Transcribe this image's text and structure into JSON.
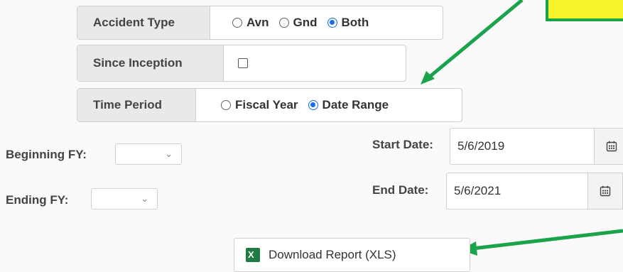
{
  "accident_type": {
    "label": "Accident Type",
    "options": [
      {
        "label": "Avn",
        "checked": false
      },
      {
        "label": "Gnd",
        "checked": false
      },
      {
        "label": "Both",
        "checked": true
      }
    ]
  },
  "since_inception": {
    "label": "Since Inception",
    "checked": false
  },
  "time_period": {
    "label": "Time Period",
    "options": [
      {
        "label": "Fiscal Year",
        "checked": false
      },
      {
        "label": "Date Range",
        "checked": true
      }
    ]
  },
  "beginning_fy": {
    "label": "Beginning FY:",
    "value": ""
  },
  "ending_fy": {
    "label": "Ending FY:",
    "value": ""
  },
  "start_date": {
    "label": "Start Date:",
    "value": "5/6/2019"
  },
  "end_date": {
    "label": "End Date:",
    "value": "5/6/2021"
  },
  "download": {
    "label": "Download Report (XLS)",
    "icon": "excel-icon"
  },
  "annotations": {
    "arrow_color": "#1aa34a",
    "callout_fill": "#f7f32a",
    "callout_border": "#1aa34a"
  }
}
